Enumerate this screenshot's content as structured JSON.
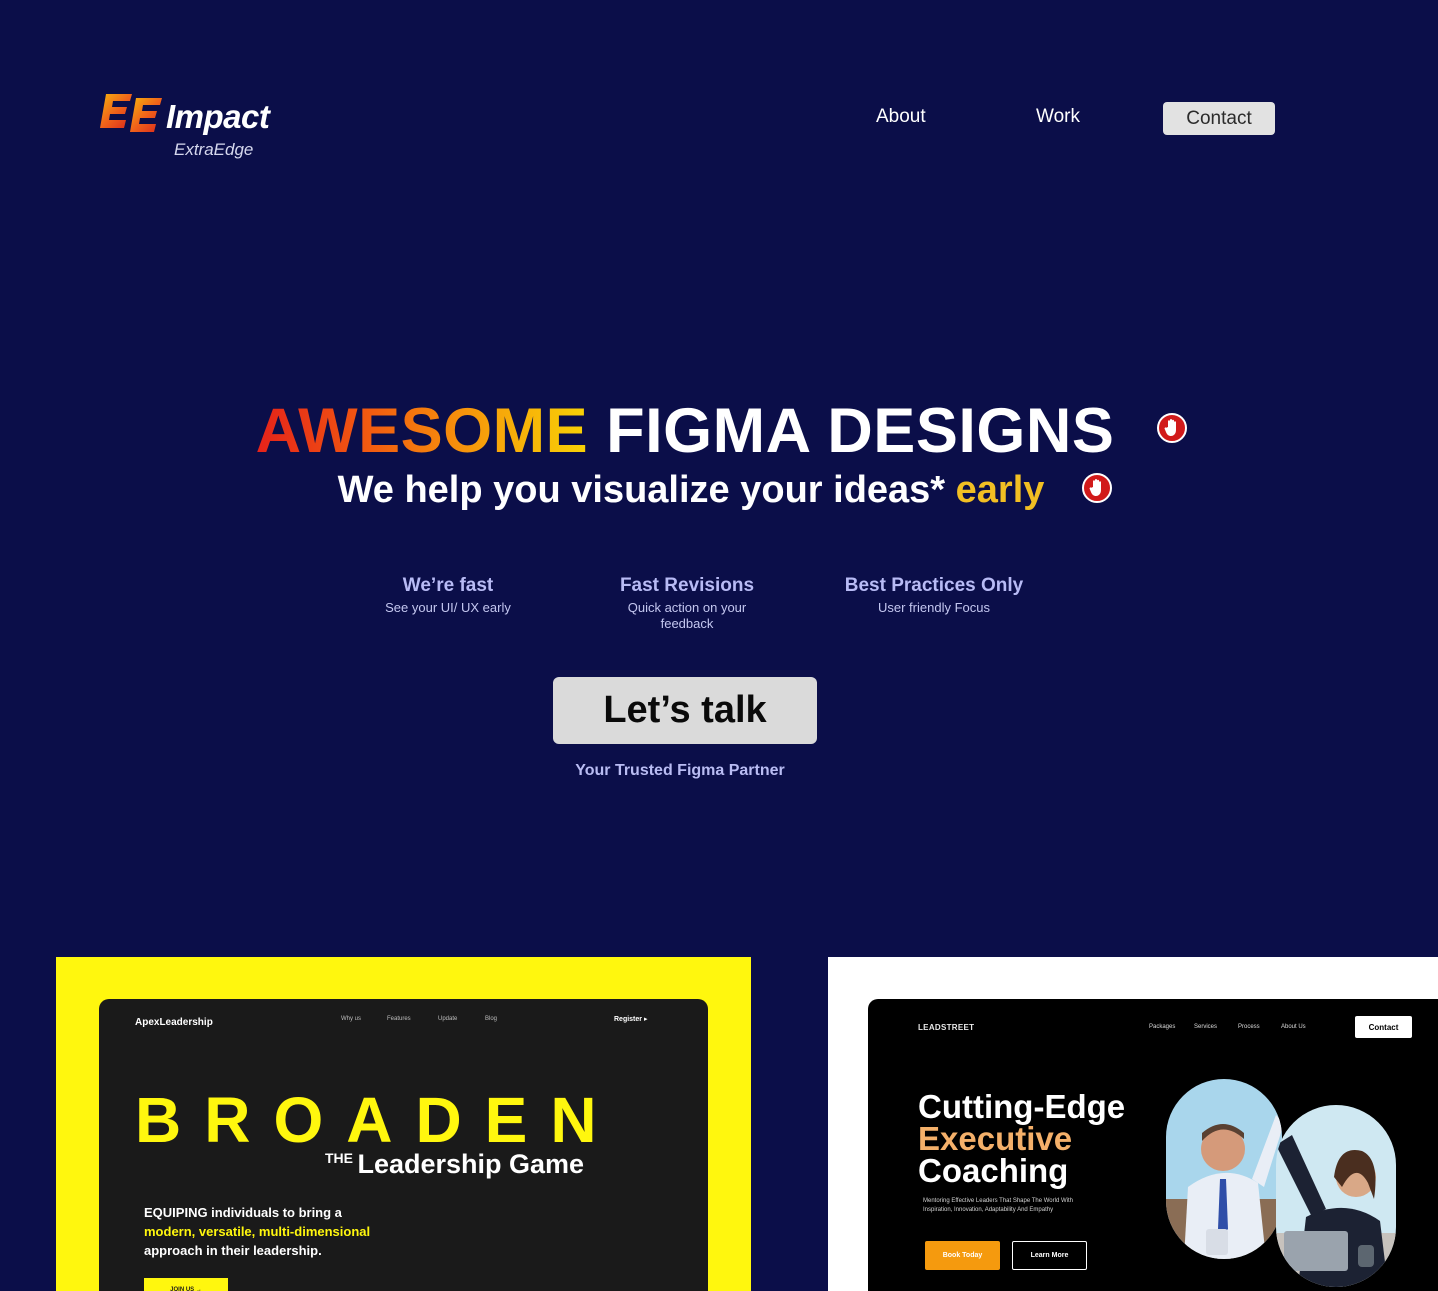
{
  "header": {
    "logo_name": "Impact",
    "logo_sub": "ExtraEdge",
    "nav": {
      "about": "About",
      "work": "Work",
      "contact": "Contact"
    }
  },
  "hero": {
    "title_gradient": "AWESOME",
    "title_rest": "FIGMA DESIGNS",
    "subtitle_main": "We help you visualize your ideas*",
    "subtitle_accent": "early",
    "features": [
      {
        "title": "We’re fast",
        "desc": "See your UI/ UX early"
      },
      {
        "title": "Fast Revisions",
        "desc": "Quick action on your feedback"
      },
      {
        "title": "Best Practices Only",
        "desc": "User friendly Focus"
      }
    ],
    "cta": "Let’s talk",
    "tagline": "Your Trusted Figma Partner"
  },
  "portfolio": {
    "apex": {
      "brand": "ApexLeadership",
      "nav": [
        "Why us",
        "Features",
        "Update",
        "Blog"
      ],
      "register": "Register ▸",
      "headline": "BROADEN",
      "the": "THE",
      "subheadline": "Leadership Game",
      "copy_line1": "EQUIPING individuals to bring a",
      "copy_line2": "modern, versatile, multi-dimensional",
      "copy_line3": "approach in their leadership.",
      "join": "JOIN US →"
    },
    "leadstreet": {
      "brand": "LEADSTREET",
      "nav": [
        "Packages",
        "Services",
        "Process",
        "About Us"
      ],
      "contact": "Contact",
      "headline_1": "Cutting-Edge",
      "headline_2": "Executive",
      "headline_3": "Coaching",
      "desc_line1": "Mentoring Effective Leaders That  Shape The World With",
      "desc_line2": "Inspiration, Innovation,  Adaptability And Empathy",
      "book": "Book Today",
      "learn": "Learn More"
    }
  },
  "colors": {
    "background": "#0b0e49",
    "accent_yellow": "#f2bf23",
    "cta_bg": "#dadada",
    "card_yellow": "#fff70e",
    "badge_red": "#d11a1a"
  },
  "icons": [
    "logo-ee-icon",
    "hand-stop-icon",
    "hand-stop-icon"
  ]
}
